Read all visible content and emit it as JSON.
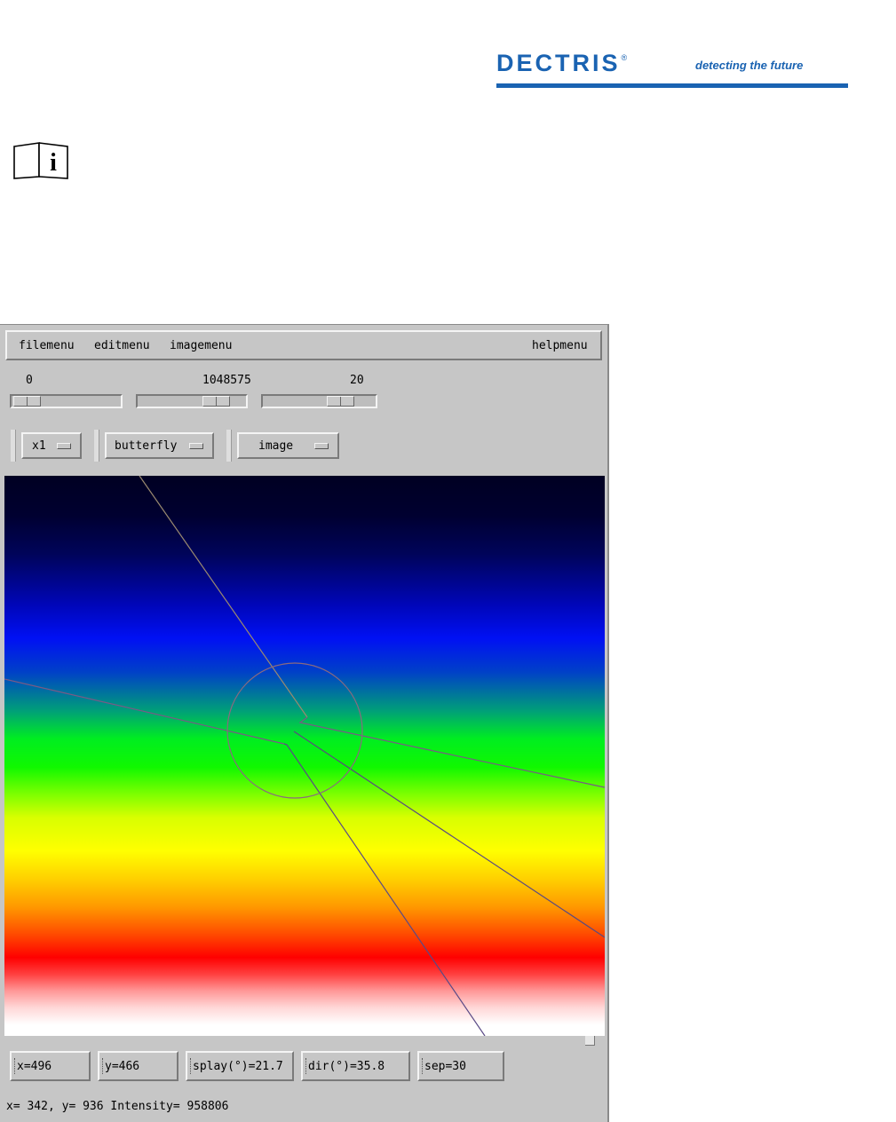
{
  "brand": {
    "wordmark": "DECTRIS",
    "registered_mark": "®",
    "tagline": "detecting the future",
    "color": "#1a63b2"
  },
  "info_icon": {
    "icon": "book-info-icon",
    "glyph": "i"
  },
  "menubar": {
    "items": [
      "filemenu",
      "editmenu",
      "imagemenu"
    ],
    "help": "helpmenu"
  },
  "sliders": [
    {
      "label": "0",
      "position": 0.02
    },
    {
      "label": "1048575",
      "position": 0.8
    },
    {
      "label": "20",
      "position": 0.75
    }
  ],
  "option_menus": [
    {
      "label": "x1"
    },
    {
      "label": "butterfly"
    },
    {
      "label": "image"
    }
  ],
  "viewer": {
    "colormap": "black-blue-green-yellow-red-white",
    "overlay_color": "#7a5a86"
  },
  "fields": [
    {
      "label": "x=496"
    },
    {
      "label": "y=466"
    },
    {
      "label": "splay(°)=21.7"
    },
    {
      "label": "dir(°)=35.8"
    },
    {
      "label": "sep=30"
    }
  ],
  "status": "x= 342, y= 936 Intensity= 958806"
}
